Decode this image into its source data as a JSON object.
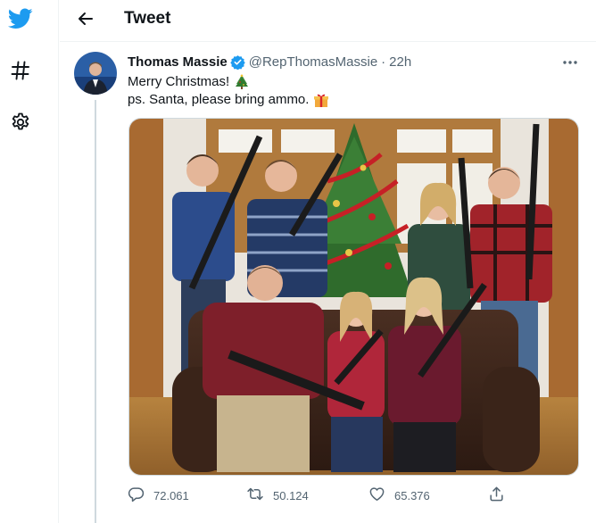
{
  "header": {
    "title": "Tweet"
  },
  "tweet": {
    "author_name": "Thomas Massie",
    "handle": "@RepThomasMassie",
    "separator": "·",
    "time": "22h",
    "text_line1": "Merry Christmas!",
    "text_line2": "ps. Santa, please bring ammo."
  },
  "stats": {
    "replies": "72.061",
    "retweets": "50.124",
    "likes": "65.376"
  },
  "colors": {
    "brand": "#1d9bf0",
    "text_primary": "#0f1419",
    "text_secondary": "#536471",
    "divider": "#eff3f4"
  },
  "icons": {
    "logo": "twitter-bird-icon",
    "explore": "hashtag-icon",
    "settings": "gear-icon",
    "back": "arrow-left-icon",
    "verified": "verified-badge-icon",
    "more": "more-dots-icon",
    "tree_emoji": "christmas-tree-emoji",
    "gift_emoji": "gift-emoji",
    "reply": "reply-icon",
    "retweet": "retweet-icon",
    "like": "heart-icon",
    "share": "share-icon"
  }
}
